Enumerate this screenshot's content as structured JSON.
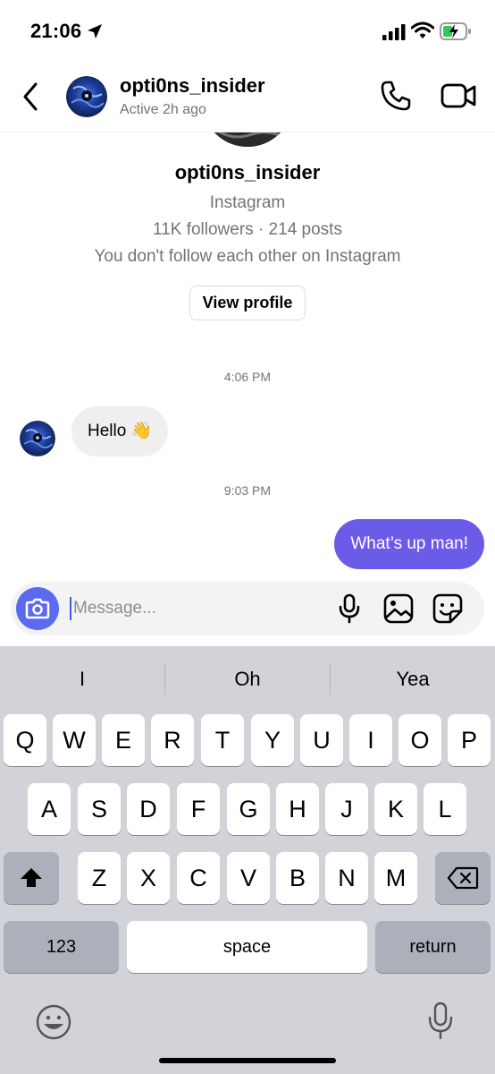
{
  "status_bar": {
    "time": "21:06",
    "icons": [
      "location-arrow-icon",
      "cellular-signal-icon",
      "wifi-icon",
      "battery-charging-icon"
    ]
  },
  "header": {
    "username": "opti0ns_insider",
    "active_status": "Active 2h ago",
    "icons": [
      "back-chevron-icon",
      "phone-icon",
      "video-camera-icon"
    ]
  },
  "profile": {
    "username": "opti0ns_insider",
    "platform": "Instagram",
    "stats": "11K followers · 214 posts",
    "relationship": "You don't follow each other on Instagram",
    "view_profile_label": "View profile"
  },
  "messages": [
    {
      "timestamp": "4:06 PM",
      "direction": "incoming",
      "text": "Hello 👋"
    },
    {
      "timestamp": "9:03 PM",
      "direction": "outgoing",
      "text": "What’s up man!"
    }
  ],
  "composer": {
    "placeholder": "Message...",
    "value": "",
    "icons": [
      "camera-icon",
      "microphone-icon",
      "gallery-icon",
      "sticker-icon"
    ]
  },
  "keyboard": {
    "suggestions": [
      "I",
      "Oh",
      "Yea"
    ],
    "rows": [
      [
        "Q",
        "W",
        "E",
        "R",
        "T",
        "Y",
        "U",
        "I",
        "O",
        "P"
      ],
      [
        "A",
        "S",
        "D",
        "F",
        "G",
        "H",
        "J",
        "K",
        "L"
      ],
      [
        "Z",
        "X",
        "C",
        "V",
        "B",
        "N",
        "M"
      ]
    ],
    "numbers_label": "123",
    "space_label": "space",
    "return_label": "return",
    "icons": [
      "shift-icon",
      "backspace-icon",
      "emoji-icon",
      "dictation-icon"
    ]
  },
  "colors": {
    "outgoing_bubble": "#6b5ce7",
    "incoming_bubble": "#efefef",
    "camera_button": "#5b6bf1",
    "keyboard_bg": "#d1d3d9",
    "secondary_text": "#737373"
  }
}
